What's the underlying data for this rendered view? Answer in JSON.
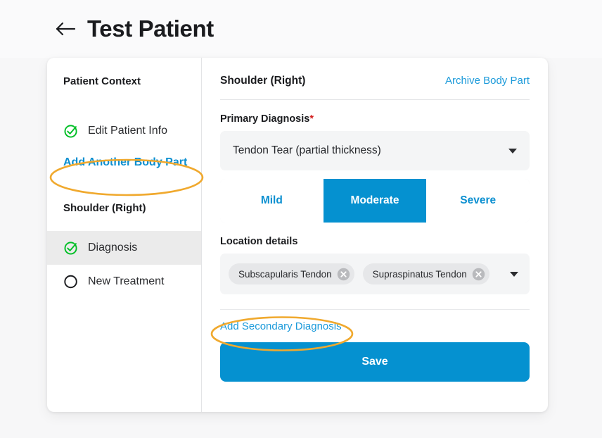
{
  "header": {
    "back_icon": "arrow-left-icon",
    "title": "Test Patient"
  },
  "colors": {
    "accent_blue": "#0591d0",
    "link_blue": "#1b9ada",
    "annotation_orange": "#f0a92e",
    "success_green": "#00bf27",
    "required_red": "#d32020",
    "page_bg": "#f7f7f8",
    "field_bg": "#f4f5f6",
    "selected_row_bg": "#ebebeb"
  },
  "sidebar": {
    "context_heading": "Patient Context",
    "context_items": [
      {
        "label": "Edit Patient Info",
        "icon": "check-circle-icon",
        "state": "complete"
      }
    ],
    "add_body_part_link": "Add Another Body Part",
    "body_part_heading": "Shoulder (Right)",
    "body_part_items": [
      {
        "label": "Diagnosis",
        "icon": "check-circle-icon",
        "state": "complete",
        "selected": true
      },
      {
        "label": "New Treatment",
        "icon": "empty-circle-icon",
        "state": "incomplete",
        "selected": false
      }
    ]
  },
  "content": {
    "title": "Shoulder (Right)",
    "archive_link": "Archive Body Part",
    "primary_diagnosis": {
      "label": "Primary Diagnosis",
      "required_marker": "*",
      "selected_value": "Tendon Tear (partial thickness)",
      "caret_icon": "chevron-down-icon"
    },
    "severity": {
      "options": [
        "Mild",
        "Moderate",
        "Severe"
      ],
      "selected": "Moderate"
    },
    "location_details": {
      "label": "Location details",
      "chips": [
        {
          "label": "Subscapularis Tendon",
          "remove_icon": "remove-circle-icon"
        },
        {
          "label": "Supraspinatus Tendon",
          "remove_icon": "remove-circle-icon"
        }
      ],
      "caret_icon": "chevron-down-icon"
    },
    "add_secondary_diagnosis_link": "Add Secondary Diagnosis",
    "save_label": "Save"
  },
  "annotations": [
    {
      "name": "add-another-body-part-highlight",
      "shape": "ellipse",
      "color": "#f0a92e"
    },
    {
      "name": "add-secondary-diagnosis-highlight",
      "shape": "ellipse",
      "color": "#f0a92e"
    }
  ]
}
